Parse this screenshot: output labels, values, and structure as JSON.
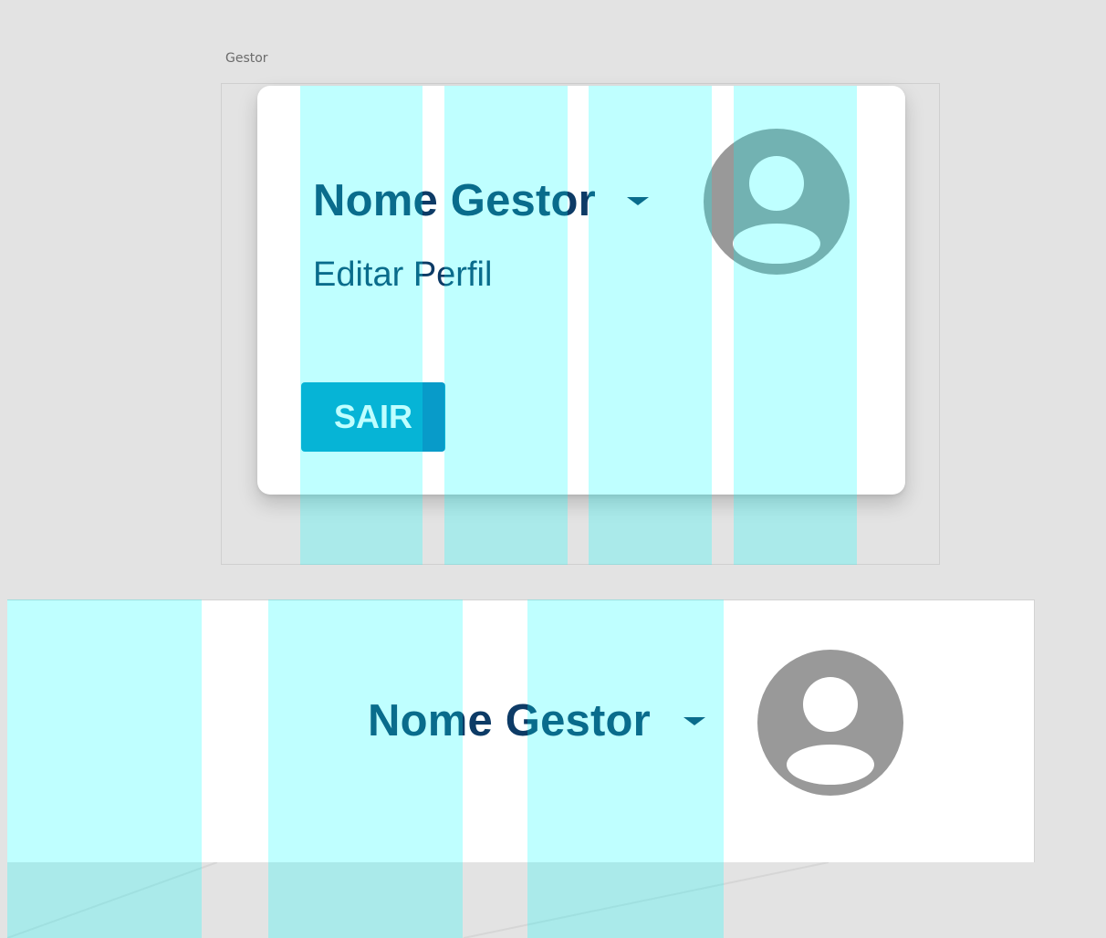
{
  "artboard": {
    "label": "Gestor"
  },
  "dropdown": {
    "user_name": "Nome Gestor",
    "edit_profile_label": "Editar Perfil",
    "logout_label": "SAIR",
    "avatar_icon": "user-avatar-icon",
    "caret_icon": "caret-down-icon"
  },
  "header": {
    "user_name": "Nome Gestor",
    "avatar_icon": "user-avatar-icon",
    "caret_icon": "caret-down-icon"
  },
  "colors": {
    "text_primary": "#0d3b66",
    "button_primary": "#089bc9",
    "avatar": "#999999",
    "grid_overlay": "#00ffff"
  }
}
